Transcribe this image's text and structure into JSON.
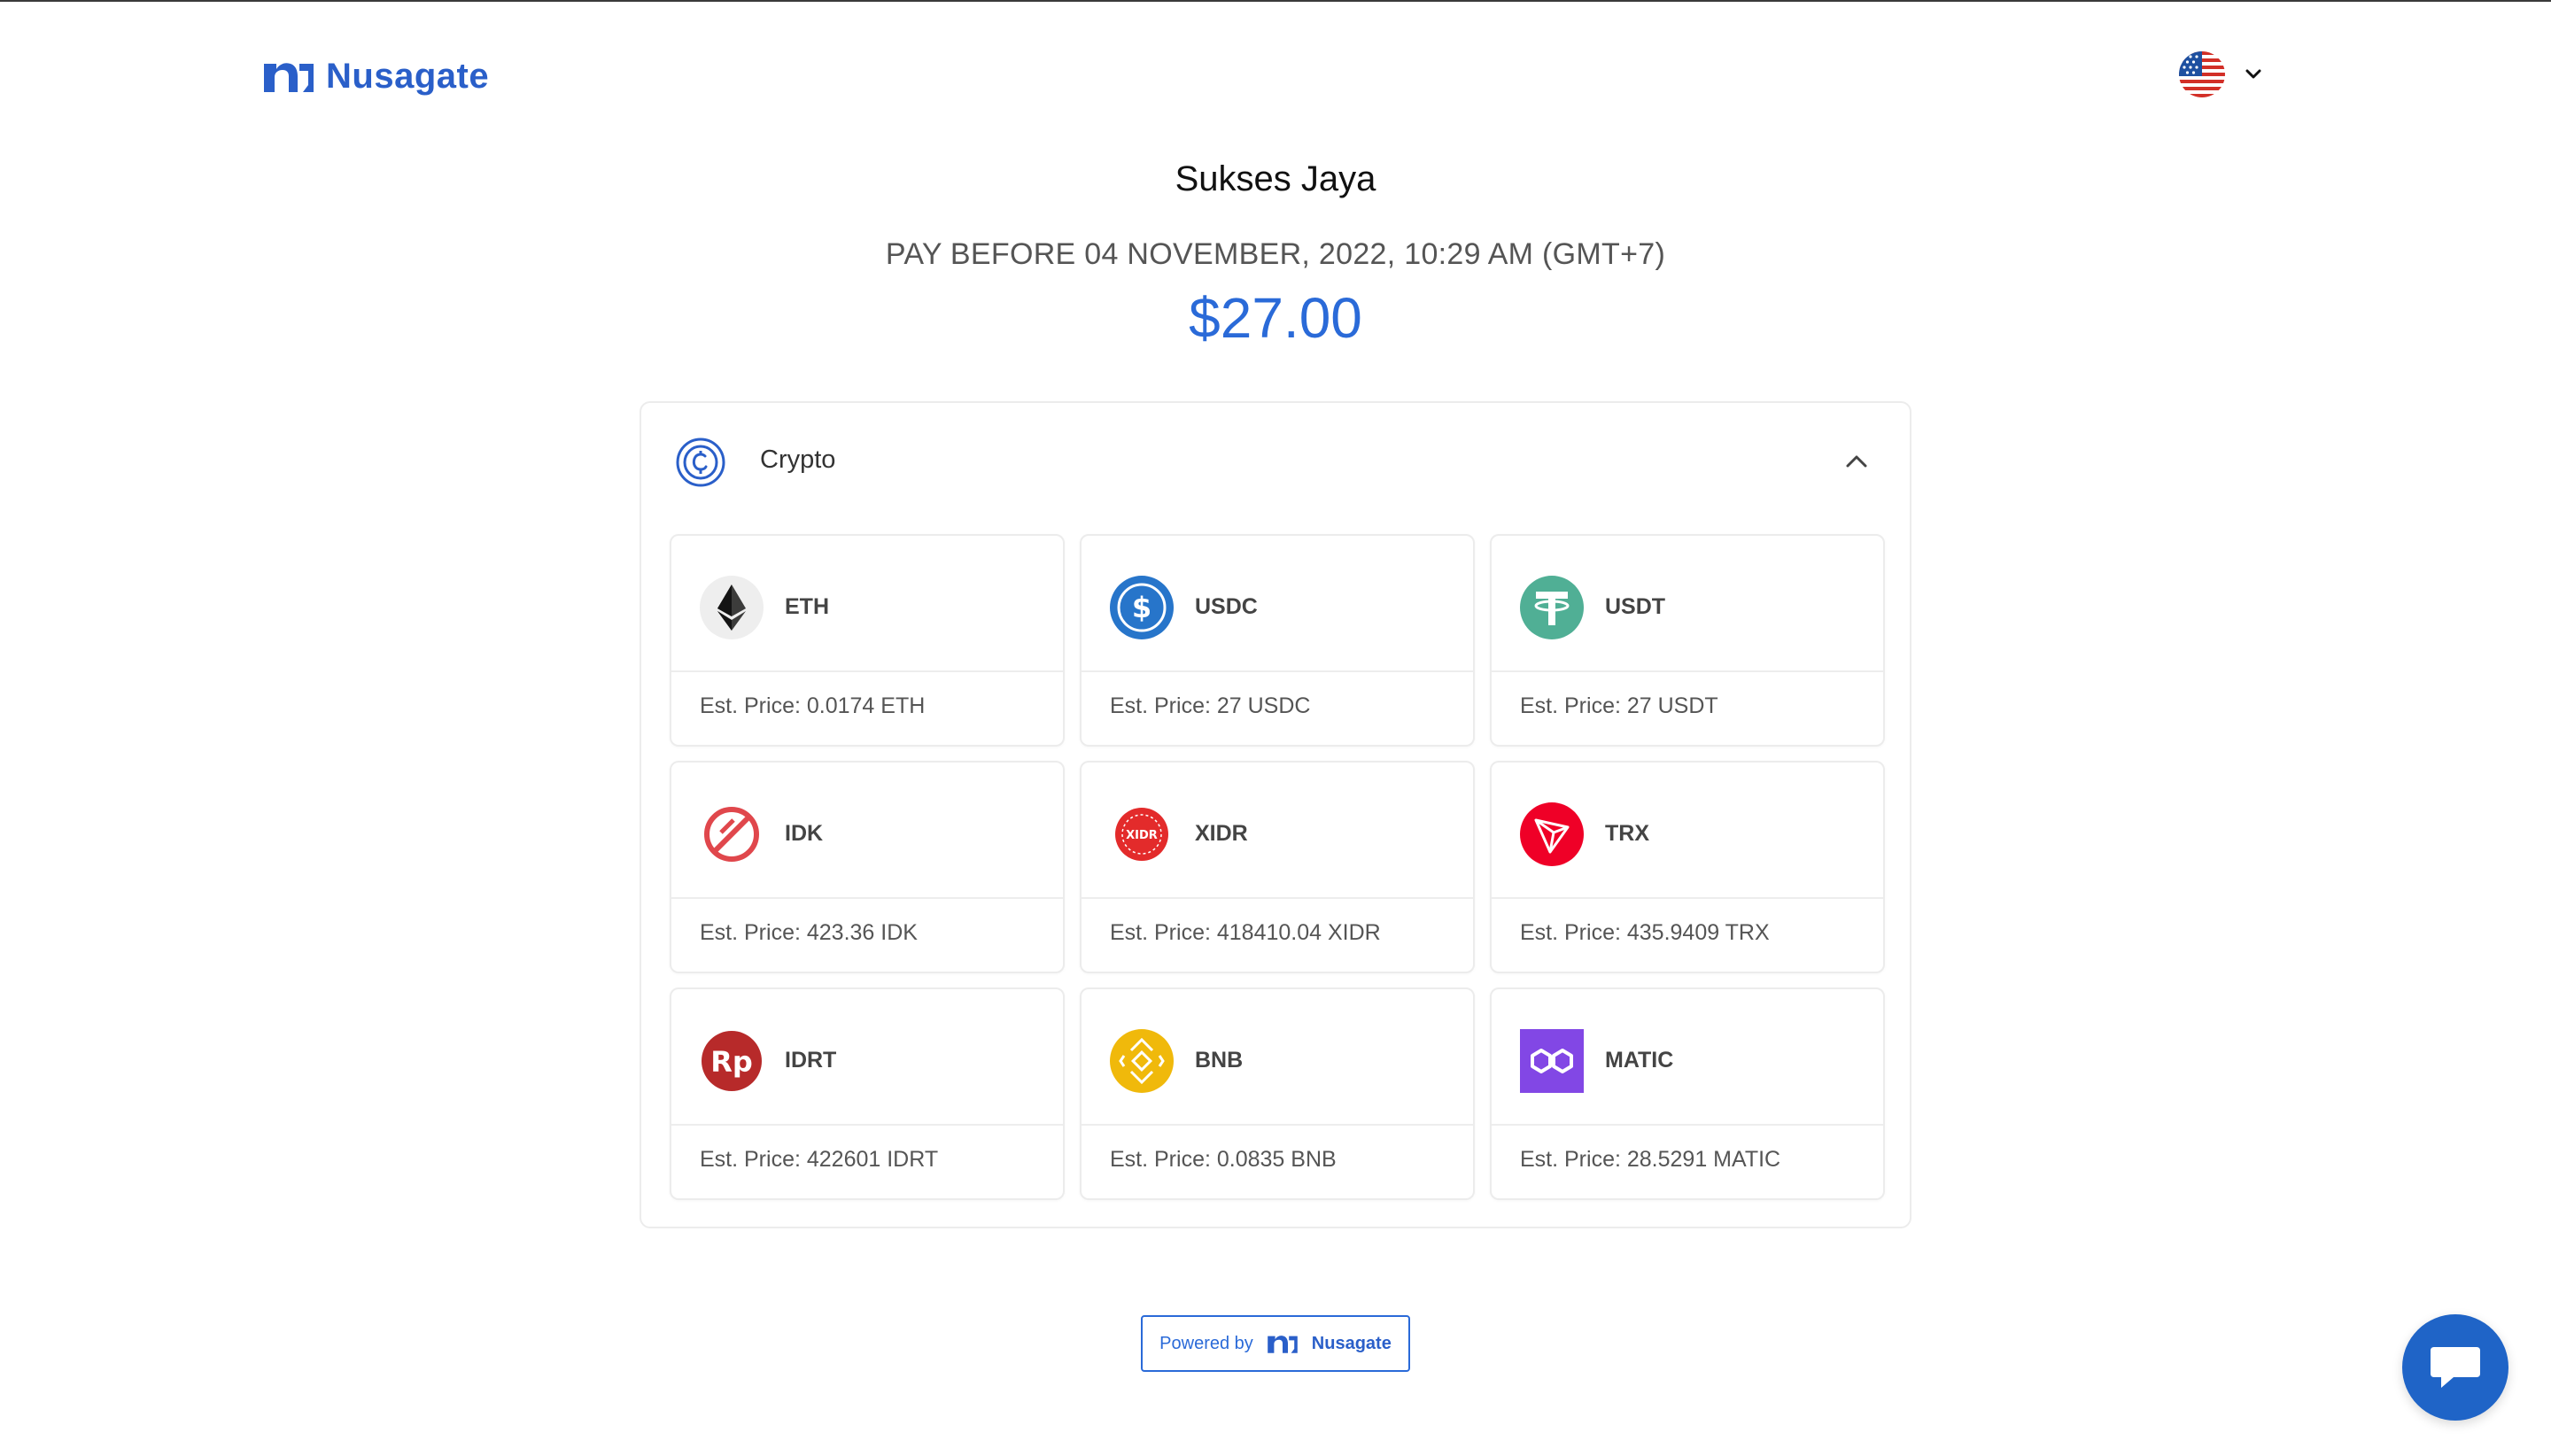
{
  "brand": {
    "name": "Nusagate",
    "color": "#2a5fc9"
  },
  "header": {
    "language_icon": "us-flag-icon",
    "language_dropdown_icon": "chevron-down-icon"
  },
  "invoice": {
    "merchant": "Sukses Jaya",
    "deadline": "PAY BEFORE 04 NOVEMBER, 2022, 10:29 AM (GMT+7)",
    "amount": "$27.00",
    "amount_color": "#2a6ad8"
  },
  "payment_section": {
    "title": "Crypto",
    "icon": "crypto-coin-icon",
    "toggle_icon": "chevron-up-icon",
    "options": [
      {
        "ticker": "ETH",
        "est_price": "Est. Price: 0.0174 ETH",
        "icon": "eth-icon"
      },
      {
        "ticker": "USDC",
        "est_price": "Est. Price: 27 USDC",
        "icon": "usdc-icon"
      },
      {
        "ticker": "USDT",
        "est_price": "Est. Price: 27 USDT",
        "icon": "usdt-icon"
      },
      {
        "ticker": "IDK",
        "est_price": "Est. Price: 423.36 IDK",
        "icon": "idk-icon"
      },
      {
        "ticker": "XIDR",
        "est_price": "Est. Price: 418410.04 XIDR",
        "icon": "xidr-icon"
      },
      {
        "ticker": "TRX",
        "est_price": "Est. Price: 435.9409 TRX",
        "icon": "trx-icon"
      },
      {
        "ticker": "IDRT",
        "est_price": "Est. Price: 422601 IDRT",
        "icon": "idrt-icon"
      },
      {
        "ticker": "BNB",
        "est_price": "Est. Price: 0.0835 BNB",
        "icon": "bnb-icon"
      },
      {
        "ticker": "MATIC",
        "est_price": "Est. Price: 28.5291 MATIC",
        "icon": "matic-icon"
      }
    ]
  },
  "footer": {
    "powered_by": "Powered by",
    "brand": "Nusagate"
  },
  "chat": {
    "icon": "chat-bubble-icon"
  }
}
